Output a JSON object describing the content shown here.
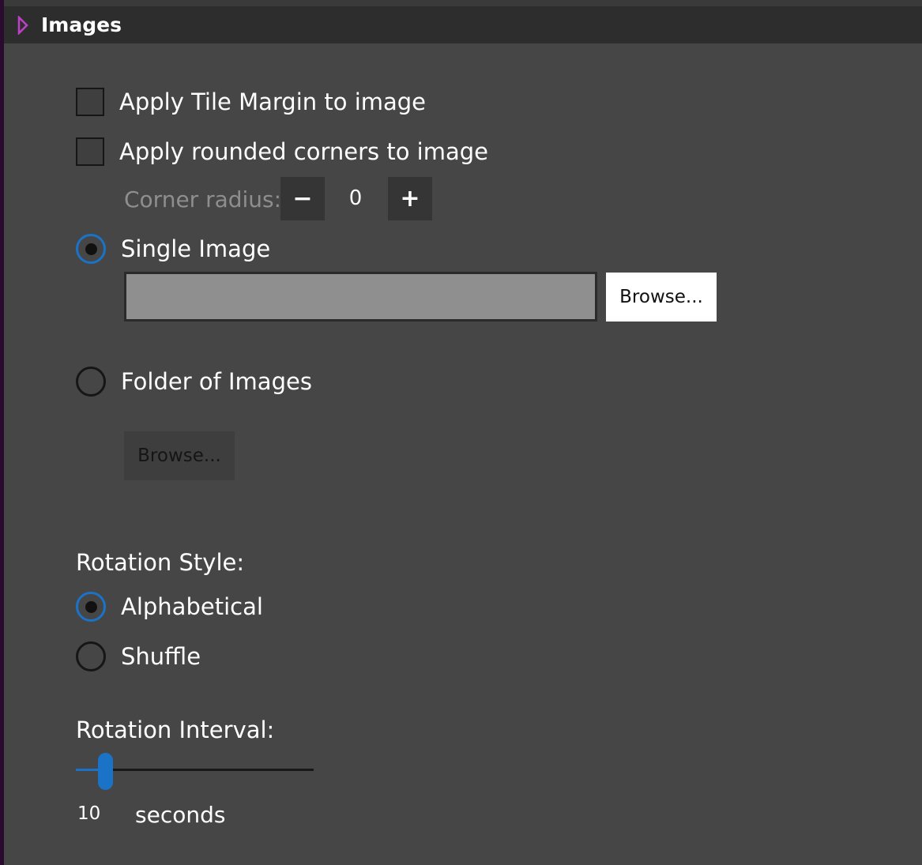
{
  "section": {
    "title": "Images",
    "expand_icon": "triangle-right-icon",
    "accent_color": "#c040c8"
  },
  "options": {
    "tile_margin": {
      "label": "Apply Tile Margin to image",
      "checked": false
    },
    "rounded_corners": {
      "label": "Apply rounded corners to image",
      "checked": false
    }
  },
  "corner_radius": {
    "label": "Corner radius:",
    "decrement_label": "−",
    "increment_label": "+",
    "value": "0",
    "enabled": false
  },
  "source": {
    "single_image": {
      "label": "Single Image",
      "selected": true,
      "path_value": "",
      "browse_label": "Browse..."
    },
    "folder": {
      "label": "Folder of Images",
      "selected": false,
      "browse_label": "Browse...",
      "enabled": false
    }
  },
  "rotation_style": {
    "label": "Rotation Style:",
    "alphabetical": {
      "label": "Alphabetical",
      "selected": true
    },
    "shuffle": {
      "label": "Shuffle",
      "selected": false
    }
  },
  "rotation_interval": {
    "label": "Rotation Interval:",
    "value": "10",
    "unit": "seconds",
    "slider_fraction": 0.12
  },
  "colors": {
    "background": "#464646",
    "header": "#2d2d2d",
    "accent_blue": "#1a73c7",
    "disabled_text": "#8e8e8e"
  }
}
